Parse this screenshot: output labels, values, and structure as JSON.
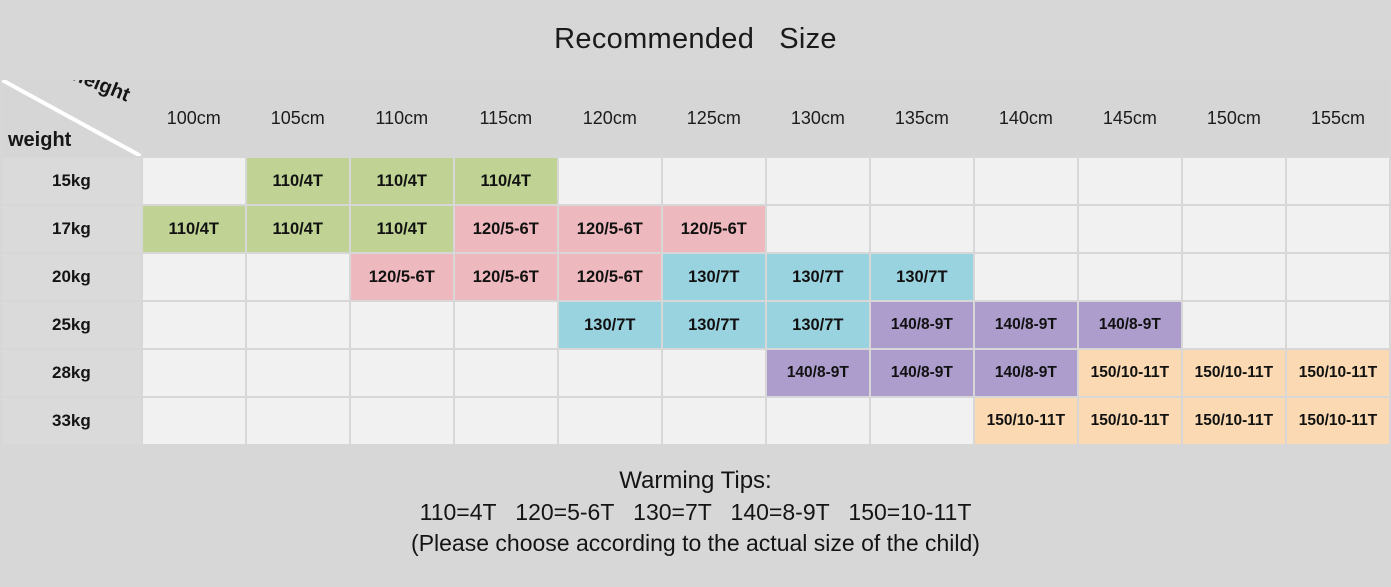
{
  "header": {
    "title": "Recommended   Size"
  },
  "table": {
    "corner": {
      "height_label": "height",
      "weight_label": "weight",
      "diagonal_icon": "diagonal-divider-icon"
    },
    "column_headers": [
      "100cm",
      "105cm",
      "110cm",
      "115cm",
      "120cm",
      "125cm",
      "130cm",
      "135cm",
      "140cm",
      "145cm",
      "150cm",
      "155cm"
    ],
    "row_headers": [
      "15kg",
      "17kg",
      "20kg",
      "25kg",
      "28kg",
      "33kg"
    ],
    "rows": [
      {
        "weight": "15kg",
        "cells": [
          {
            "text": "",
            "color": "empty"
          },
          {
            "text": "110/4T",
            "color": "green"
          },
          {
            "text": "110/4T",
            "color": "green"
          },
          {
            "text": "110/4T",
            "color": "green"
          },
          {
            "text": "",
            "color": "empty"
          },
          {
            "text": "",
            "color": "empty"
          },
          {
            "text": "",
            "color": "empty"
          },
          {
            "text": "",
            "color": "empty"
          },
          {
            "text": "",
            "color": "empty"
          },
          {
            "text": "",
            "color": "empty"
          },
          {
            "text": "",
            "color": "empty"
          },
          {
            "text": "",
            "color": "empty"
          }
        ]
      },
      {
        "weight": "17kg",
        "cells": [
          {
            "text": "110/4T",
            "color": "green"
          },
          {
            "text": "110/4T",
            "color": "green"
          },
          {
            "text": "110/4T",
            "color": "green"
          },
          {
            "text": "120/5-6T",
            "color": "pink"
          },
          {
            "text": "120/5-6T",
            "color": "pink"
          },
          {
            "text": "120/5-6T",
            "color": "pink"
          },
          {
            "text": "",
            "color": "empty"
          },
          {
            "text": "",
            "color": "empty"
          },
          {
            "text": "",
            "color": "empty"
          },
          {
            "text": "",
            "color": "empty"
          },
          {
            "text": "",
            "color": "empty"
          },
          {
            "text": "",
            "color": "empty"
          }
        ]
      },
      {
        "weight": "20kg",
        "cells": [
          {
            "text": "",
            "color": "empty"
          },
          {
            "text": "",
            "color": "empty"
          },
          {
            "text": "120/5-6T",
            "color": "pink"
          },
          {
            "text": "120/5-6T",
            "color": "pink"
          },
          {
            "text": "120/5-6T",
            "color": "pink"
          },
          {
            "text": "130/7T",
            "color": "blue"
          },
          {
            "text": "130/7T",
            "color": "blue"
          },
          {
            "text": "130/7T",
            "color": "blue"
          },
          {
            "text": "",
            "color": "empty"
          },
          {
            "text": "",
            "color": "empty"
          },
          {
            "text": "",
            "color": "empty"
          },
          {
            "text": "",
            "color": "empty"
          }
        ]
      },
      {
        "weight": "25kg",
        "cells": [
          {
            "text": "",
            "color": "empty"
          },
          {
            "text": "",
            "color": "empty"
          },
          {
            "text": "",
            "color": "empty"
          },
          {
            "text": "",
            "color": "empty"
          },
          {
            "text": "130/7T",
            "color": "blue"
          },
          {
            "text": "130/7T",
            "color": "blue"
          },
          {
            "text": "130/7T",
            "color": "blue"
          },
          {
            "text": "140/8-9T",
            "color": "purple"
          },
          {
            "text": "140/8-9T",
            "color": "purple"
          },
          {
            "text": "140/8-9T",
            "color": "purple"
          },
          {
            "text": "",
            "color": "empty"
          },
          {
            "text": "",
            "color": "empty"
          }
        ]
      },
      {
        "weight": "28kg",
        "cells": [
          {
            "text": "",
            "color": "empty"
          },
          {
            "text": "",
            "color": "empty"
          },
          {
            "text": "",
            "color": "empty"
          },
          {
            "text": "",
            "color": "empty"
          },
          {
            "text": "",
            "color": "empty"
          },
          {
            "text": "",
            "color": "empty"
          },
          {
            "text": "140/8-9T",
            "color": "purple"
          },
          {
            "text": "140/8-9T",
            "color": "purple"
          },
          {
            "text": "140/8-9T",
            "color": "purple"
          },
          {
            "text": "150/10-11T",
            "color": "orange"
          },
          {
            "text": "150/10-11T",
            "color": "orange"
          },
          {
            "text": "150/10-11T",
            "color": "orange"
          }
        ]
      },
      {
        "weight": "33kg",
        "cells": [
          {
            "text": "",
            "color": "empty"
          },
          {
            "text": "",
            "color": "empty"
          },
          {
            "text": "",
            "color": "empty"
          },
          {
            "text": "",
            "color": "empty"
          },
          {
            "text": "",
            "color": "empty"
          },
          {
            "text": "",
            "color": "empty"
          },
          {
            "text": "",
            "color": "empty"
          },
          {
            "text": "",
            "color": "empty"
          },
          {
            "text": "150/10-11T",
            "color": "orange"
          },
          {
            "text": "150/10-11T",
            "color": "orange"
          },
          {
            "text": "150/10-11T",
            "color": "orange"
          },
          {
            "text": "150/10-11T",
            "color": "orange"
          }
        ]
      }
    ]
  },
  "tips": {
    "title": "Warming Tips:",
    "legend": "110=4T   120=5-6T   130=7T   140=8-9T   150=10-11T",
    "note": "(Please choose according to the actual size of the child)"
  },
  "colors": {
    "page_background": "#d7d7d7",
    "header_cell": "#d6d6d6",
    "row_header_cell": "#dadada",
    "empty_cell": "#f1f1f1",
    "green": "#c0d394",
    "pink": "#eeb9be",
    "blue": "#9ad3e0",
    "purple": "#ad9dcd",
    "orange": "#fbd9b2",
    "text": "#141414"
  },
  "chart_data": {
    "type": "table",
    "title": "Recommended   Size",
    "xlabel": "height",
    "ylabel": "weight",
    "categories": [
      "100cm",
      "105cm",
      "110cm",
      "115cm",
      "120cm",
      "125cm",
      "130cm",
      "135cm",
      "140cm",
      "145cm",
      "150cm",
      "155cm"
    ],
    "row_categories": [
      "15kg",
      "17kg",
      "20kg",
      "25kg",
      "28kg",
      "33kg"
    ],
    "legend": [
      "110/4T",
      "120/5-6T",
      "130/7T",
      "140/8-9T",
      "150/10-11T"
    ],
    "values": [
      [
        "",
        "110/4T",
        "110/4T",
        "110/4T",
        "",
        "",
        "",
        "",
        "",
        "",
        "",
        ""
      ],
      [
        "110/4T",
        "110/4T",
        "110/4T",
        "120/5-6T",
        "120/5-6T",
        "120/5-6T",
        "",
        "",
        "",
        "",
        "",
        ""
      ],
      [
        "",
        "",
        "120/5-6T",
        "120/5-6T",
        "120/5-6T",
        "130/7T",
        "130/7T",
        "130/7T",
        "",
        "",
        "",
        ""
      ],
      [
        "",
        "",
        "",
        "",
        "130/7T",
        "130/7T",
        "130/7T",
        "140/8-9T",
        "140/8-9T",
        "140/8-9T",
        "",
        ""
      ],
      [
        "",
        "",
        "",
        "",
        "",
        "",
        "140/8-9T",
        "140/8-9T",
        "140/8-9T",
        "150/10-11T",
        "150/10-11T",
        "150/10-11T"
      ],
      [
        "",
        "",
        "",
        "",
        "",
        "",
        "",
        "",
        "150/10-11T",
        "150/10-11T",
        "150/10-11T",
        "150/10-11T"
      ]
    ],
    "grid": true,
    "legend_position": "none"
  }
}
